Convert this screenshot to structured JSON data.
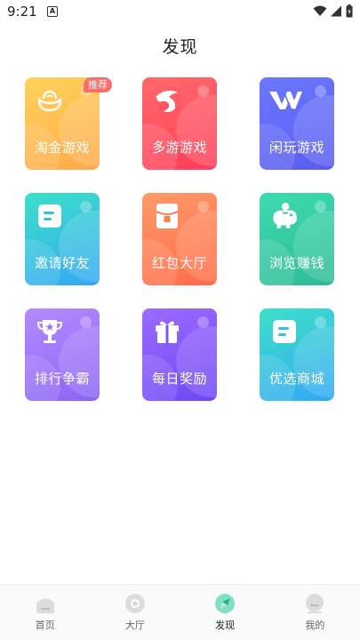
{
  "status": {
    "time": "9:21",
    "notif_glyph": "A"
  },
  "header": {
    "title": "发现"
  },
  "tiles": [
    {
      "label": "淘金游戏",
      "badge": "推荐",
      "icon": "gold-ingot-icon",
      "gradient": [
        "#ffd35a",
        "#ffa94a"
      ]
    },
    {
      "label": "多游游戏",
      "icon": "dolphin-logo-icon",
      "gradient": [
        "#ff6a6a",
        "#ff3e5a"
      ]
    },
    {
      "label": "闲玩游戏",
      "icon": "xianwan-logo-icon",
      "gradient": [
        "#6b78ff",
        "#5a5cf0"
      ]
    },
    {
      "label": "邀请好友",
      "icon": "invite-card-icon",
      "gradient": [
        "#3de0c8",
        "#33a8f5"
      ]
    },
    {
      "label": "红包大厅",
      "icon": "red-envelope-icon",
      "gradient": [
        "#ff9a6a",
        "#ff6b45"
      ]
    },
    {
      "label": "浏览赚钱",
      "icon": "piggy-bank-icon",
      "gradient": [
        "#3edbb0",
        "#2dbb98"
      ]
    },
    {
      "label": "排行争霸",
      "icon": "trophy-icon",
      "gradient": [
        "#b58bff",
        "#8a64f5"
      ]
    },
    {
      "label": "每日奖励",
      "icon": "gift-icon",
      "gradient": [
        "#9c6bff",
        "#6f47f5"
      ]
    },
    {
      "label": "优选商城",
      "icon": "shop-card-icon",
      "gradient": [
        "#3de0c8",
        "#33a8f5"
      ]
    }
  ],
  "nav": [
    {
      "label": "首页",
      "icon": "home-icon",
      "active": false
    },
    {
      "label": "大厅",
      "icon": "lobby-icon",
      "active": false
    },
    {
      "label": "发现",
      "icon": "discover-icon",
      "active": true
    },
    {
      "label": "我的",
      "icon": "profile-icon",
      "active": false
    }
  ]
}
